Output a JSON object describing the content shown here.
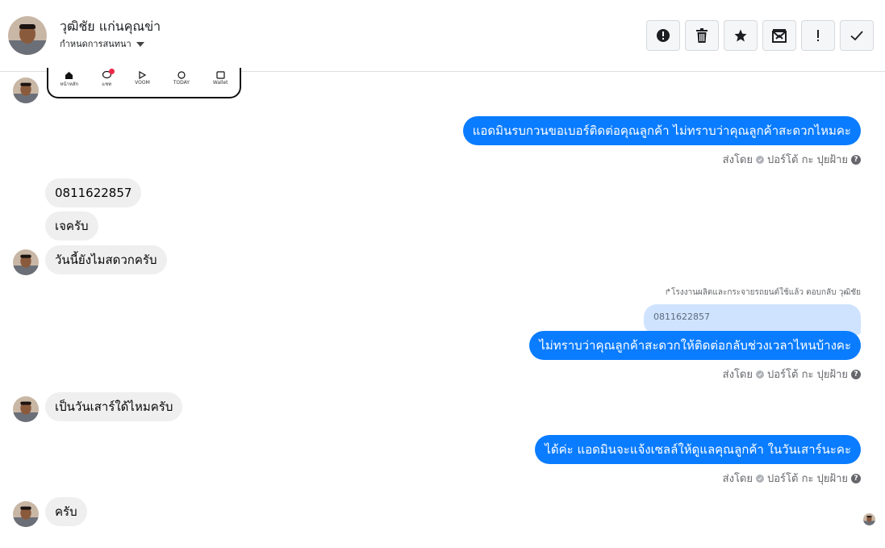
{
  "header": {
    "contact_name": "วุฒิชัย แก่นคุณข่า",
    "sub_label": "กำหนดการสนทนา",
    "toolbar": [
      {
        "name": "alert-circle-icon"
      },
      {
        "name": "trash-icon"
      },
      {
        "name": "star-icon"
      },
      {
        "name": "mail-x-icon"
      },
      {
        "name": "exclamation-icon"
      },
      {
        "name": "check-icon"
      }
    ]
  },
  "phone_card": {
    "tabs": [
      "หน้าหลัก",
      "แชท",
      "VOOM",
      "TODAY",
      "Wallet"
    ]
  },
  "messages": {
    "out1": "แอดมินรบกวนขอเบอร์ติดต่อคุณลูกค้า ไม่ทราบว่าคุณลูกค้าสะดวกไหมคะ",
    "in1": "0811622857",
    "in2": "เจครับ",
    "in3": "วันนี้ยังไมสดวกครับ",
    "reply_note": "โรงงานผลิตและกระจายรถยนต์ใช้แล้ว ตอบกลับ วุฒิชัย",
    "quote": "0811622857",
    "out2": "ไม่ทราบว่าคุณลูกค้าสะดวกให้ติดต่อกลับช่วงเวลาไหนบ้างคะ",
    "in4": "เป็นวันเสาร์ใด้ไหมครับ",
    "out3": "ได้ค่ะ แอดมินจะแจ้งเซลล์ให้ดูแลคุณลูกค้า ในวันเสาร์นะคะ",
    "in5": "ครับ"
  },
  "sent_by": {
    "prefix": "ส่งโดย",
    "name": "ปอร์โต้ กะ ปุยฝ้าย",
    "help": "?"
  }
}
